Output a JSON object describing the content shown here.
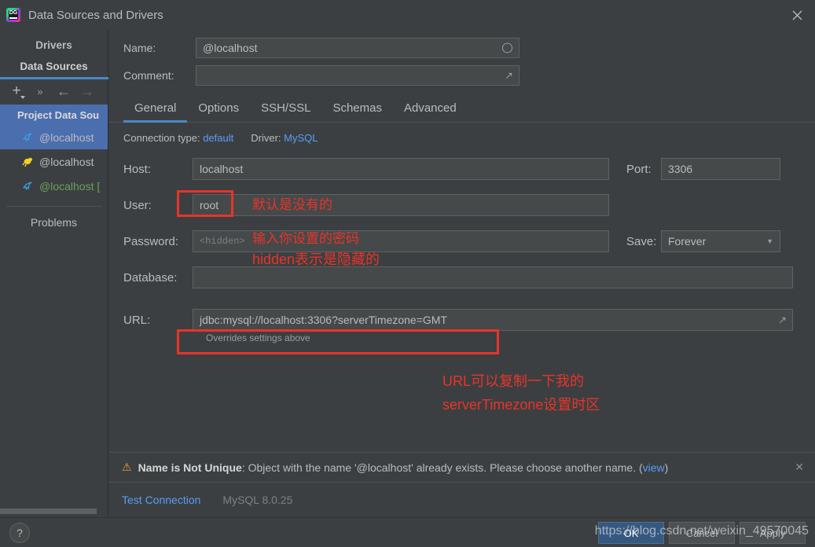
{
  "window": {
    "title": "Data Sources and Drivers",
    "logo_text": "DG",
    "close_icon": "close-icon"
  },
  "sidebar": {
    "tabs": [
      {
        "label": "Drivers",
        "active": false
      },
      {
        "label": "Data Sources",
        "active": true
      }
    ],
    "toolbar": [
      {
        "name": "add-button",
        "glyph": "+"
      },
      {
        "name": "expand-all-button",
        "glyph": "»"
      },
      {
        "name": "back-button",
        "glyph": "←"
      },
      {
        "name": "forward-button",
        "glyph": "→"
      }
    ],
    "group_label": "Project Data Sou",
    "items": [
      {
        "label": "@localhost",
        "icon": "mysql-dolphin-icon",
        "selected": true,
        "color": "default"
      },
      {
        "label": "@localhost",
        "icon": "sqlite-icon",
        "selected": false,
        "color": "default"
      },
      {
        "label": "@localhost [",
        "icon": "mysql-dolphin-icon",
        "selected": false,
        "color": "green"
      }
    ],
    "problems_label": "Problems"
  },
  "form": {
    "name_label": "Name:",
    "name_value": "@localhost",
    "comment_label": "Comment:",
    "comment_value": "",
    "comment_placeholder": ""
  },
  "tabs": [
    {
      "label": "General",
      "active": true
    },
    {
      "label": "Options",
      "active": false
    },
    {
      "label": "SSH/SSL",
      "active": false
    },
    {
      "label": "Schemas",
      "active": false
    },
    {
      "label": "Advanced",
      "active": false
    }
  ],
  "connection": {
    "type_label": "Connection type:",
    "type_value": "default",
    "driver_label": "Driver:",
    "driver_value": "MySQL"
  },
  "fields": {
    "host_label": "Host:",
    "host_value": "localhost",
    "port_label": "Port:",
    "port_value": "3306",
    "user_label": "User:",
    "user_value": "root",
    "password_label": "Password:",
    "password_placeholder": "<hidden>",
    "save_label": "Save:",
    "save_value": "Forever",
    "database_label": "Database:",
    "database_value": "",
    "url_label": "URL:",
    "url_value": "jdbc:mysql://localhost:3306?serverTimezone=GMT",
    "url_hint": "Overrides settings above"
  },
  "annotations": [
    {
      "name": "user-annotation",
      "text": "默认是没有的"
    },
    {
      "name": "password-annotation-1",
      "text": "输入你设置的密码"
    },
    {
      "name": "password-annotation-2",
      "text": "hidden表示是隐藏的"
    },
    {
      "name": "url-annotation-1",
      "text": "URL可以复制一下我的"
    },
    {
      "name": "url-annotation-2",
      "text": "serverTimezone设置时区"
    }
  ],
  "warning": {
    "icon": "warning-triangle-icon",
    "strong": "Name is Not Unique",
    "text": ": Object with the name '@localhost' already exists. Please choose another name. (",
    "link": "view",
    "text_end": ")",
    "close_icon": "close-icon"
  },
  "footer": {
    "test_connection": "Test Connection",
    "driver_version": "MySQL 8.0.25",
    "help_label": "?",
    "ok_label": "OK",
    "cancel_label": "Cancel",
    "apply_label": "Apply",
    "watermark": "https://blog.csdn.net/weixin_49570045"
  },
  "colors": {
    "accent_blue": "#4a88c7",
    "link_blue": "#589df6",
    "selection_blue": "#4b6eaf",
    "annotation_red": "#e8342a",
    "warning_orange": "#e8a33d",
    "green_text": "#6a9f5b",
    "background": "#3c3f41"
  }
}
